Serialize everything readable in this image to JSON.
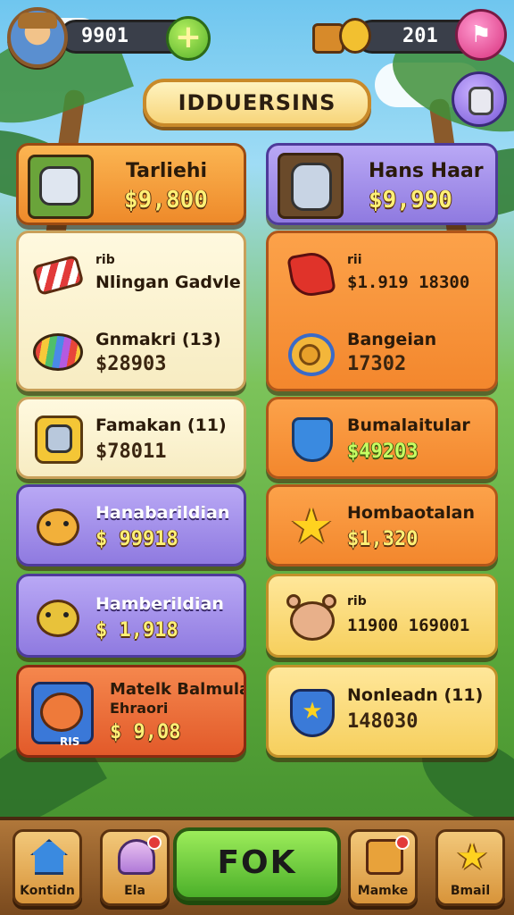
{
  "header": {
    "coins": "9901",
    "gems": "201"
  },
  "title": "IDDUERSINS",
  "featured": [
    {
      "name": "Tarliehi",
      "price": "$9,800"
    },
    {
      "name": "Hans Haar",
      "price": "$9,990"
    }
  ],
  "left_items": [
    {
      "name_small": "rib",
      "name": "Nlingan Gadvle",
      "price": ""
    },
    {
      "name": "Gnmakri (13)",
      "price": "$28903"
    },
    {
      "name": "Famakan (11)",
      "price": "$78011"
    },
    {
      "name": "Hanabarildian",
      "price": "$ 99918"
    },
    {
      "name": "Hamberildian",
      "price": "$ 1,918"
    },
    {
      "name": "Matelk Balmula",
      "name2": "Ehraori",
      "price": "$ 9,08",
      "tag": "RIS"
    }
  ],
  "right_items": [
    {
      "name_small": "rii",
      "name": "$1.919 18300",
      "price": ""
    },
    {
      "name": "Bangeian",
      "price": "17302"
    },
    {
      "name": "Bumalaitular",
      "price": "$49203"
    },
    {
      "name": "Hombaotalan",
      "price": "$1,320"
    },
    {
      "name_small": "rib",
      "name": "11900 169001",
      "price": ""
    },
    {
      "name": "Nonleadn (11)",
      "price": "148030"
    }
  ],
  "bottom_nav": {
    "home": "Kontidn",
    "hat": "Ela",
    "ok": "FOK",
    "mail": "Mamke",
    "star": "Bmail"
  },
  "colors": {
    "ok_green": "#4cb02a",
    "card_orange": "#ee8a2a",
    "card_purple": "#8f7ae0",
    "card_cream": "#f7ecc2"
  }
}
